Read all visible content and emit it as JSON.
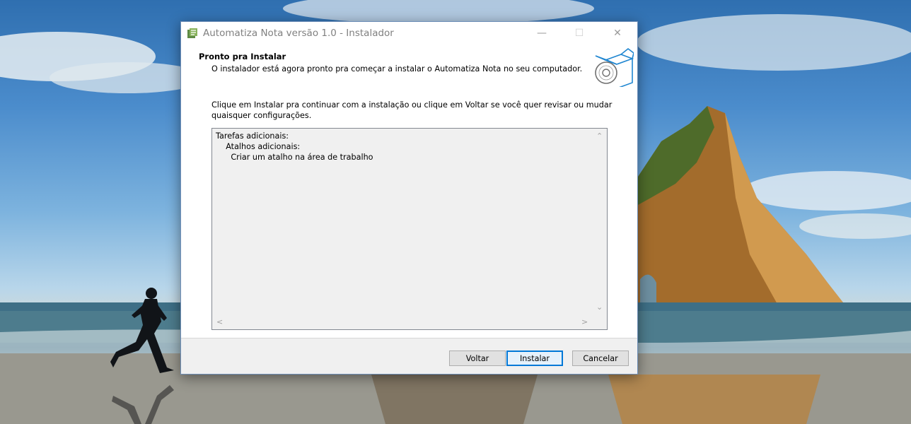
{
  "window": {
    "title": "Automatiza Nota versão 1.0 - Instalador",
    "controls": {
      "minimize": "—",
      "maximize": "☐",
      "close": "✕"
    }
  },
  "header": {
    "title": "Pronto pra Instalar",
    "subtitle": "O instalador está agora pronto pra começar a instalar o Automatiza Nota no seu computador."
  },
  "content": {
    "instruction": "Clique em Instalar pra continuar com a instalação ou clique em Voltar se você quer revisar ou mudar quaisquer configurações.",
    "memo_lines": [
      "Tarefas adicionais:",
      "    Atalhos adicionais:",
      "      Criar um atalho na área de trabalho"
    ],
    "scroll_arrows": {
      "up": "⌃",
      "down": "⌄",
      "left": "<",
      "right": ">"
    }
  },
  "footer": {
    "back_label": "Voltar",
    "install_label": "Instalar",
    "cancel_label": "Cancelar"
  },
  "icons": {
    "app": "installer-app-icon",
    "header": "open-box-with-disc-icon"
  },
  "colors": {
    "accent": "#0078d7",
    "footer_bg": "#f0f0f0",
    "memo_bg": "#f0f0f0"
  }
}
